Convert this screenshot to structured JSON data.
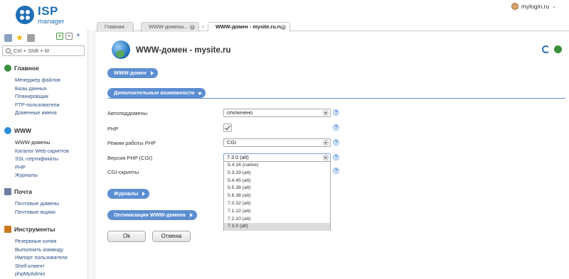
{
  "header": {
    "logo_text": "ISP",
    "logo_sub": "manager",
    "user": "mylogin.ru"
  },
  "sidebar": {
    "search_placeholder": "Ctrl + Shift + M",
    "groups": [
      {
        "title": "Главное",
        "items": [
          "Менеджер файлов",
          "Базы данных",
          "Планировщик",
          "FTP-пользователи",
          "Доменные имена"
        ]
      },
      {
        "title": "WWW",
        "items": [
          "WWW-домены",
          "Каталог Web-скриптов",
          "SSL-сертификаты",
          "PHP",
          "Журналы"
        ]
      },
      {
        "title": "Почта",
        "items": [
          "Почтовые домены",
          "Почтовые ящики"
        ]
      },
      {
        "title": "Инструменты",
        "items": [
          "Резервные копии",
          "Выполнить команду",
          "Импорт пользователя",
          "Shell-клиент",
          "phpMyAdmin"
        ]
      }
    ]
  },
  "tabs": [
    {
      "label": "Главная"
    },
    {
      "label": "WWW-домены..."
    },
    {
      "label": "WWW-домен - mysite.ru.ru"
    }
  ],
  "page": {
    "title": "WWW-домен - mysite.ru",
    "section_www": "WWW-домен",
    "section_extra": "Дополнительные возможности",
    "section_logs": "Журналы",
    "section_opt": "Оптимизация WWW-домена"
  },
  "form": {
    "autosubdomains_label": "Автоподдомены",
    "autosubdomains_value": "отключено",
    "php_label": "PHP",
    "php_mode_label": "Режим работы PHP",
    "php_mode_value": "CGI",
    "php_version_label": "Версия PHP (CGI)",
    "php_version_value": "7.3.0 (alt)",
    "cgi_label": "CGI-скрипты",
    "php_version_options": [
      "5.4.16 (native)",
      "5.3.29 (alt)",
      "5.4.45 (alt)",
      "5.5.38 (alt)",
      "5.6.38 (alt)",
      "7.0.32 (alt)",
      "7.1.22 (alt)",
      "7.2.10 (alt)",
      "7.3.0 (alt)"
    ]
  },
  "buttons": {
    "ok": "Ok",
    "cancel": "Отмена"
  },
  "help_glyph": "?"
}
